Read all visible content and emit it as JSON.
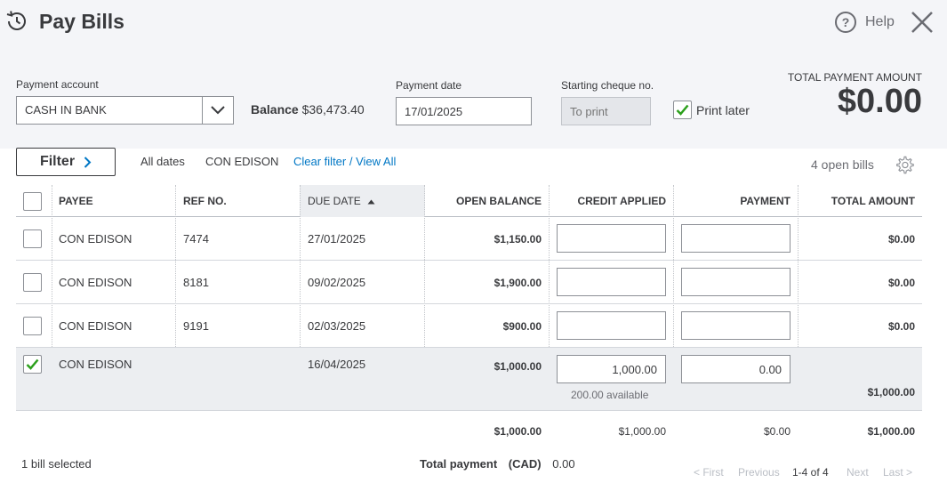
{
  "header": {
    "title": "Pay Bills",
    "help_label": "Help",
    "icons": {
      "recent": "recent-transactions-icon",
      "help": "help-icon",
      "close": "close-icon"
    }
  },
  "form": {
    "payment_account_label": "Payment account",
    "payment_account_value": "CASH IN BANK",
    "balance_label": "Balance",
    "balance_value": "$36,473.40",
    "payment_date_label": "Payment date",
    "payment_date_value": "17/01/2025",
    "cheque_label": "Starting cheque no.",
    "cheque_placeholder": "To print",
    "print_later_label": "Print later",
    "print_later_checked": true,
    "total_label": "TOTAL PAYMENT AMOUNT",
    "total_value": "$0.00"
  },
  "filter": {
    "button_label": "Filter",
    "dates": "All dates",
    "payee": "CON EDISON",
    "clear_label": "Clear filter / View All",
    "open_bills": "4 open bills"
  },
  "table": {
    "columns": [
      "PAYEE",
      "REF NO.",
      "DUE DATE",
      "OPEN BALANCE",
      "CREDIT APPLIED",
      "PAYMENT",
      "TOTAL AMOUNT"
    ],
    "sorted_column": "DUE DATE",
    "rows": [
      {
        "checked": false,
        "payee": "CON EDISON",
        "ref": "7474",
        "due": "27/01/2025",
        "open_balance": "$1,150.00",
        "credit": "",
        "payment": "",
        "total": "$0.00",
        "available": ""
      },
      {
        "checked": false,
        "payee": "CON EDISON",
        "ref": "8181",
        "due": "09/02/2025",
        "open_balance": "$1,900.00",
        "credit": "",
        "payment": "",
        "total": "$0.00",
        "available": ""
      },
      {
        "checked": false,
        "payee": "CON EDISON",
        "ref": "9191",
        "due": "02/03/2025",
        "open_balance": "$900.00",
        "credit": "",
        "payment": "",
        "total": "$0.00",
        "available": ""
      },
      {
        "checked": true,
        "payee": "CON EDISON",
        "ref": "",
        "due": "16/04/2025",
        "open_balance": "$1,000.00",
        "credit": "1,000.00",
        "payment": "0.00",
        "total": "$1,000.00",
        "available": "200.00 available"
      }
    ],
    "totals": {
      "open_balance": "$1,000.00",
      "credit": "$1,000.00",
      "payment": "$0.00",
      "total": "$1,000.00"
    }
  },
  "footer": {
    "selected": "1 bill selected",
    "total_payment_label": "Total payment",
    "currency": "(CAD)",
    "total_payment_value": "0.00",
    "pager": {
      "first": "< First",
      "previous": "Previous",
      "range": "1-4 of 4",
      "next": "Next",
      "last": "Last >"
    }
  },
  "colors": {
    "header_bg": "#f4f5f8",
    "link": "#0077c5",
    "check": "#2ca01c",
    "selected_row": "#eceef1"
  }
}
